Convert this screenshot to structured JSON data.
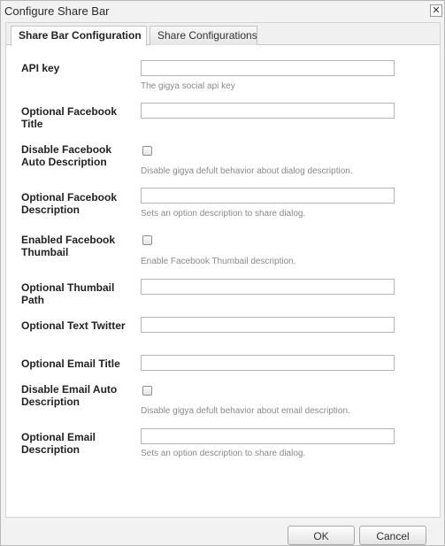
{
  "window": {
    "title": "Configure Share Bar",
    "close_glyph": "✕"
  },
  "tabs": [
    {
      "label": "Share Bar Configuration",
      "active": true
    },
    {
      "label": "Share Configurations",
      "active": false
    }
  ],
  "fields": [
    {
      "label": "API key",
      "type": "text",
      "value": "",
      "help": "The gigya social api key"
    },
    {
      "label": "Optional Facebook Title",
      "type": "text",
      "value": "",
      "help": ""
    },
    {
      "label": "Disable Facebook Auto Description",
      "type": "checkbox",
      "checked": false,
      "help": "Disable gigya defult behavior about dialog description."
    },
    {
      "label": "Optional Facebook Description",
      "type": "text",
      "value": "",
      "help": "Sets an option description to share dialog."
    },
    {
      "label": "Enabled Facebook Thumbail",
      "type": "checkbox",
      "checked": false,
      "help": "Enable Facebook Thumbail description."
    },
    {
      "label": "Optional Thumbail Path",
      "type": "text",
      "value": "",
      "help": ""
    },
    {
      "label": "Optional Text Twitter",
      "type": "text",
      "value": "",
      "help": ""
    },
    {
      "label": "Optional Email Title",
      "type": "text",
      "value": "",
      "help": ""
    },
    {
      "label": "Disable Email Auto Description",
      "type": "checkbox",
      "checked": false,
      "help": "Disable gigya defult behavior about email description."
    },
    {
      "label": "Optional Email Description",
      "type": "text",
      "value": "",
      "help": "Sets an option description to share dialog."
    }
  ],
  "buttons": {
    "ok": "OK",
    "cancel": "Cancel"
  }
}
